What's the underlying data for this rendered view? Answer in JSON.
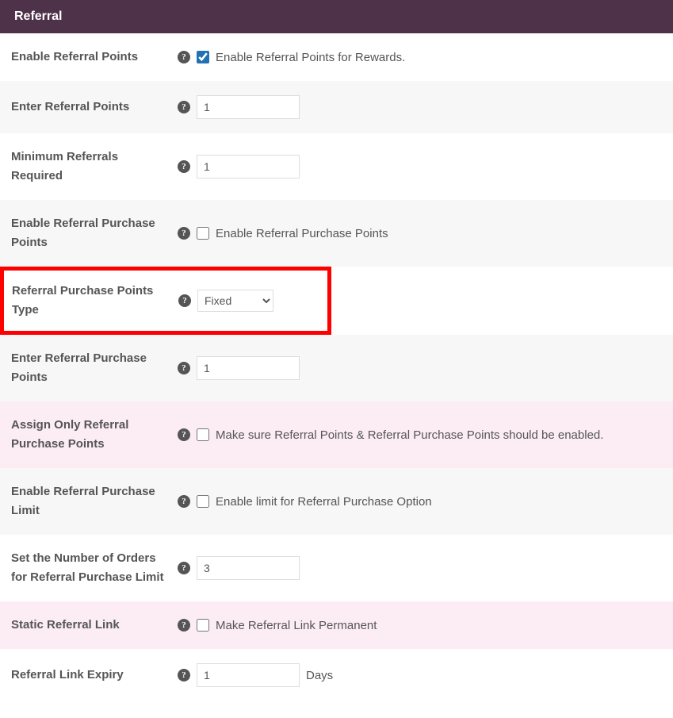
{
  "panel": {
    "title": "Referral"
  },
  "rows": {
    "enable_referral_points": {
      "label": "Enable Referral Points",
      "checked": true,
      "desc": "Enable Referral Points for Rewards."
    },
    "enter_referral_points": {
      "label": "Enter Referral Points",
      "value": "1"
    },
    "minimum_referrals_required": {
      "label": "Minimum Referrals Required",
      "value": "1"
    },
    "enable_referral_purchase_points": {
      "label": "Enable Referral Purchase Points",
      "checked": false,
      "desc": "Enable Referral Purchase Points"
    },
    "referral_purchase_points_type": {
      "label": "Referral Purchase Points Type",
      "value": "Fixed"
    },
    "enter_referral_purchase_points": {
      "label": "Enter Referral Purchase Points",
      "value": "1"
    },
    "assign_only_referral_purchase_points": {
      "label": "Assign Only Referral Purchase Points",
      "checked": false,
      "desc": "Make sure Referral Points & Referral Purchase Points should be enabled."
    },
    "enable_referral_purchase_limit": {
      "label": "Enable Referral Purchase Limit",
      "checked": false,
      "desc": "Enable limit for Referral Purchase Option"
    },
    "set_number_orders_referral_limit": {
      "label": "Set the Number of Orders for Referral Purchase Limit",
      "value": "3"
    },
    "static_referral_link": {
      "label": "Static Referral Link",
      "checked": false,
      "desc": "Make Referral Link Permanent"
    },
    "referral_link_expiry": {
      "label": "Referral Link Expiry",
      "value": "1",
      "suffix": "Days"
    }
  }
}
